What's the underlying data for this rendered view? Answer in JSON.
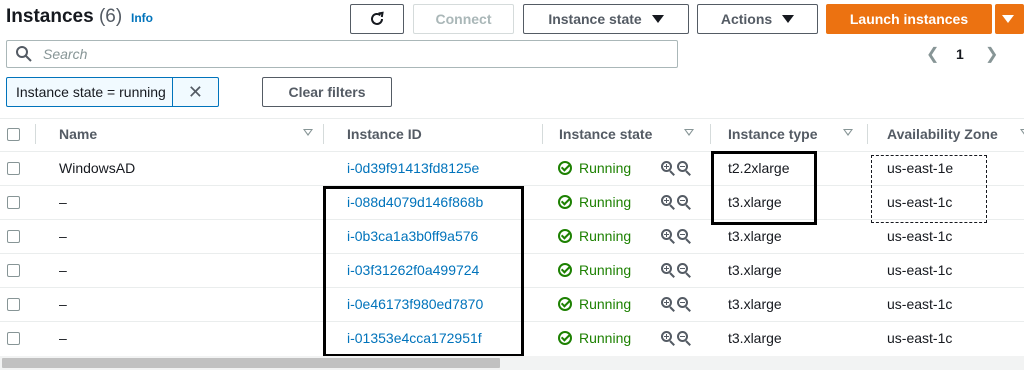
{
  "header": {
    "title": "Instances",
    "count": "(6)",
    "info": "Info",
    "connect": "Connect",
    "instance_state": "Instance state",
    "actions": "Actions",
    "launch": "Launch instances"
  },
  "search": {
    "placeholder": "Search"
  },
  "pagination": {
    "page": "1"
  },
  "filter": {
    "token": "Instance state = running",
    "clear": "Clear filters"
  },
  "columns": [
    "Name",
    "Instance ID",
    "Instance state",
    "Instance type",
    "Availability Zone"
  ],
  "rows": [
    {
      "name": "WindowsAD",
      "id": "i-0d39f91413fd8125e",
      "state": "Running",
      "type": "t2.2xlarge",
      "az": "us-east-1e"
    },
    {
      "name": "–",
      "id": "i-088d4079d146f868b",
      "state": "Running",
      "type": "t3.xlarge",
      "az": "us-east-1c"
    },
    {
      "name": "–",
      "id": "i-0b3ca1a3b0ff9a576",
      "state": "Running",
      "type": "t3.xlarge",
      "az": "us-east-1c"
    },
    {
      "name": "–",
      "id": "i-03f31262f0a499724",
      "state": "Running",
      "type": "t3.xlarge",
      "az": "us-east-1c"
    },
    {
      "name": "–",
      "id": "i-0e46173f980ed7870",
      "state": "Running",
      "type": "t3.xlarge",
      "az": "us-east-1c"
    },
    {
      "name": "–",
      "id": "i-01353e4cca172951f",
      "state": "Running",
      "type": "t3.xlarge",
      "az": "us-east-1c"
    }
  ],
  "colors": {
    "link": "#0073bb",
    "running": "#1d8102",
    "primary": "#ec7211"
  }
}
